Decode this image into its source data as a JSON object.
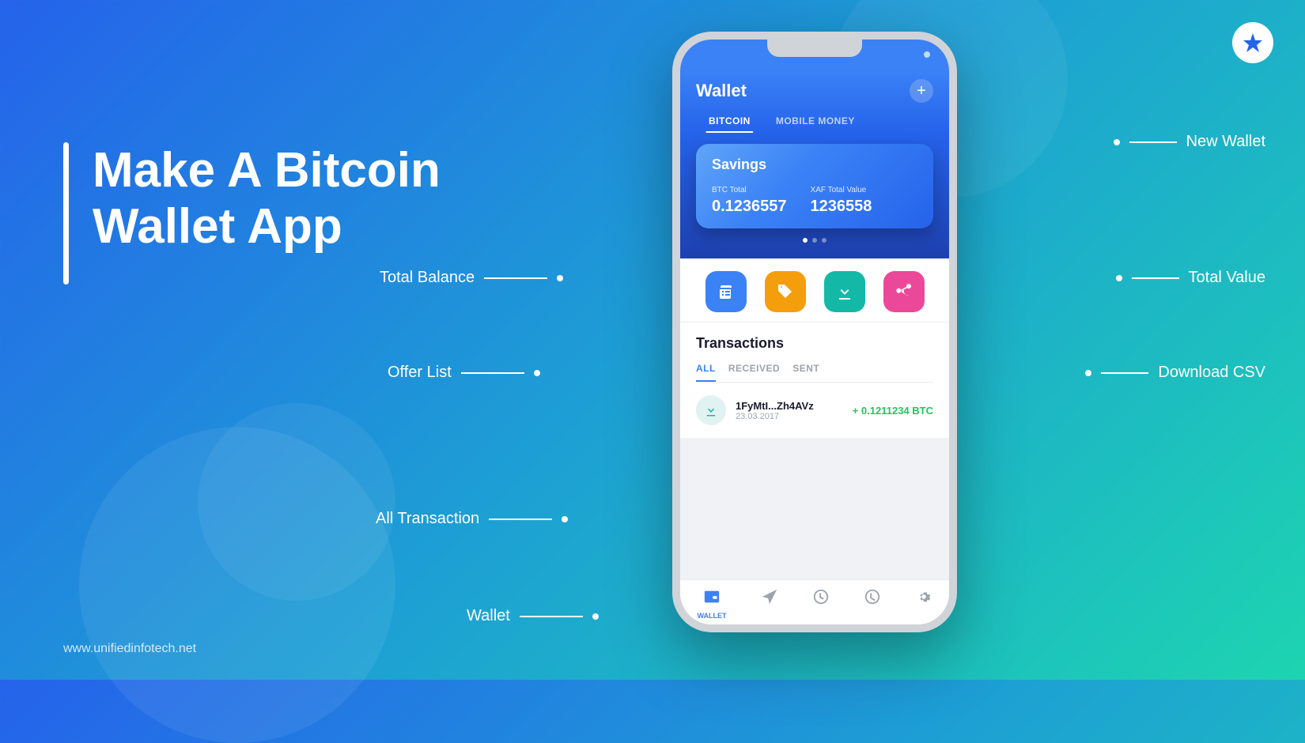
{
  "background": {
    "gradient_start": "#2563eb",
    "gradient_end": "#1dd4b0"
  },
  "logo": {
    "symbol": "✦",
    "aria": "Unified Infotech Logo"
  },
  "headline": {
    "line1": "Make A Bitcoin",
    "line2": "Wallet App"
  },
  "website": "www.unifiedinfotech.net",
  "annotations": {
    "new_wallet": "New Wallet",
    "total_balance": "Total Balance",
    "total_value": "Total Value",
    "offer_list": "Offer List",
    "download_csv": "Download CSV",
    "all_transaction": "All Transaction",
    "wallet_bottom": "Wallet"
  },
  "phone": {
    "header": {
      "title": "Wallet",
      "plus_icon": "+",
      "tabs": [
        {
          "label": "BITCOIN",
          "active": true
        },
        {
          "label": "MOBILE MONEY",
          "active": false
        }
      ]
    },
    "savings_card": {
      "label": "Savings",
      "btc_label": "BTC Total",
      "btc_value": "0.1236557",
      "xaf_label": "XAF Total Value",
      "xaf_value": "1236558"
    },
    "actions": [
      {
        "icon": "🛒",
        "color": "blue",
        "label": "offer-list-icon"
      },
      {
        "icon": "🏷️",
        "color": "yellow",
        "label": "tag-icon"
      },
      {
        "icon": "📥",
        "color": "teal",
        "label": "download-icon"
      },
      {
        "icon": "📤",
        "color": "pink",
        "label": "share-icon"
      }
    ],
    "transactions": {
      "title": "Transactions",
      "tabs": [
        {
          "label": "ALL",
          "active": true
        },
        {
          "label": "RECEIVED",
          "active": false
        },
        {
          "label": "SENT",
          "active": false
        }
      ],
      "items": [
        {
          "address": "1FyMtI...Zh4AVz",
          "date": "23.03.2017",
          "amount": "+ 0.1211234 BTC"
        }
      ]
    },
    "bottom_nav": [
      {
        "icon": "👛",
        "label": "WALLET",
        "active": true
      },
      {
        "icon": "↗",
        "label": "",
        "active": false
      },
      {
        "icon": "⏱",
        "label": "",
        "active": false
      },
      {
        "icon": "🕐",
        "label": "",
        "active": false
      },
      {
        "icon": "⚙",
        "label": "",
        "active": false
      }
    ]
  }
}
